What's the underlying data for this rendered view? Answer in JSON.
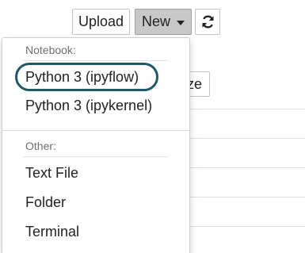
{
  "toolbar": {
    "upload_label": "Upload",
    "new_label": "New",
    "refresh_icon": "refresh-icon"
  },
  "background": {
    "partial_button_text": "ze"
  },
  "menu": {
    "notebook_header": "Notebook:",
    "items_notebook": [
      {
        "label": "Python 3 (ipyflow)"
      },
      {
        "label": "Python 3 (ipykernel)"
      }
    ],
    "other_header": "Other:",
    "items_other": [
      {
        "label": "Text File"
      },
      {
        "label": "Folder"
      },
      {
        "label": "Terminal"
      }
    ]
  },
  "colors": {
    "highlight_ring": "#1e5a66",
    "new_button_bg": "#c8c8c8"
  }
}
